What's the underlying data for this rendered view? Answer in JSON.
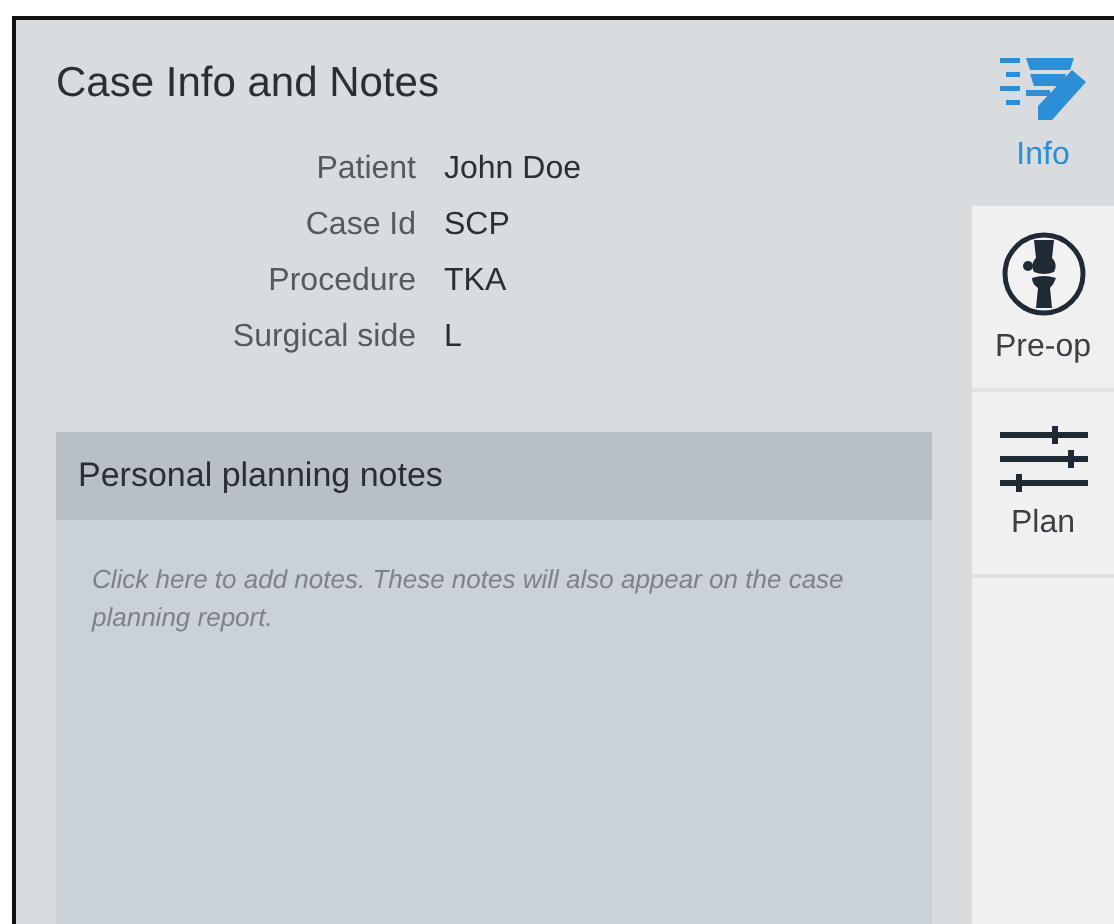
{
  "panel": {
    "title": "Case Info and Notes"
  },
  "fields": [
    {
      "label": "Patient",
      "value": "John Doe"
    },
    {
      "label": "Case Id",
      "value": "SCP"
    },
    {
      "label": "Procedure",
      "value": "TKA"
    },
    {
      "label": "Surgical side",
      "value": "L"
    }
  ],
  "notes": {
    "title": "Personal planning notes",
    "placeholder": "Click here to add notes. These notes will also appear on the case planning report."
  },
  "tabs": [
    {
      "label": "Info",
      "kind": "info",
      "selected": true
    },
    {
      "label": "Pre-op",
      "kind": "preop",
      "selected": false
    },
    {
      "label": "Plan",
      "kind": "plan",
      "selected": false
    }
  ]
}
